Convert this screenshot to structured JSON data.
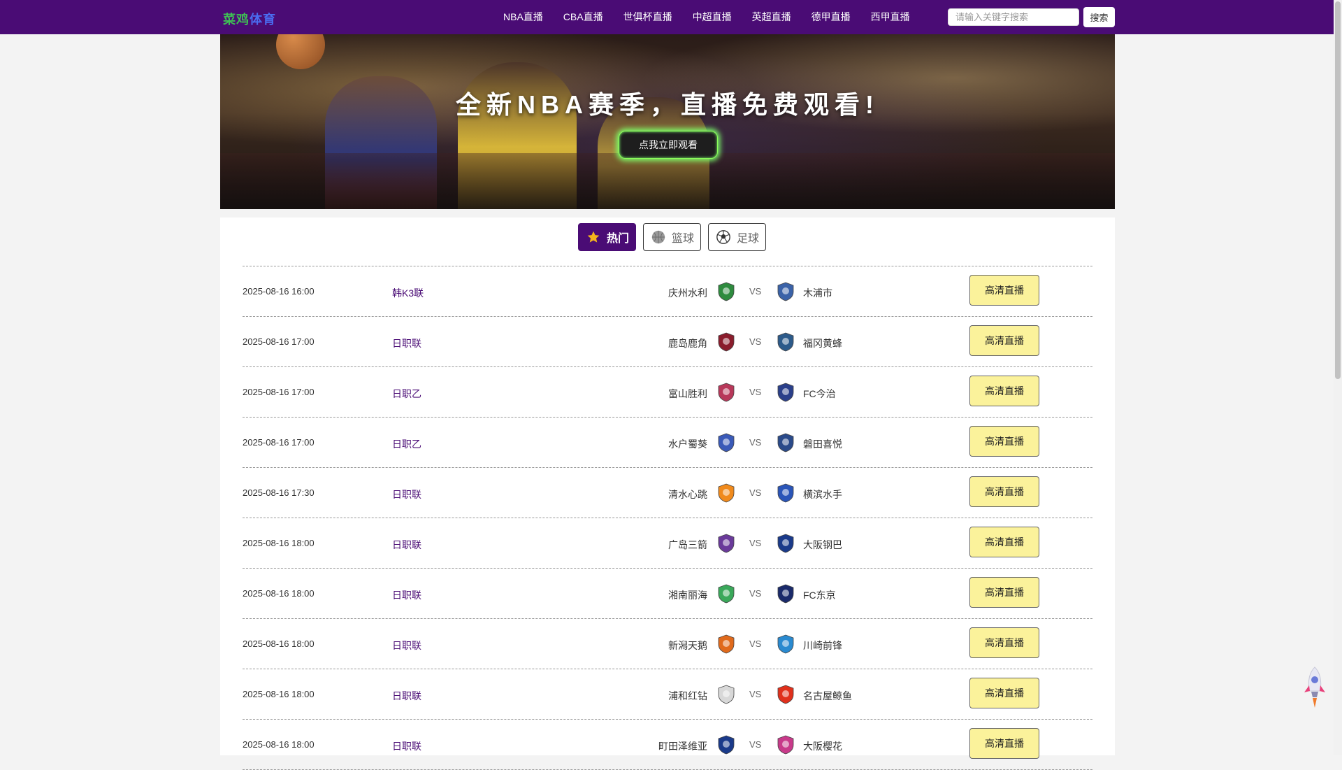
{
  "header": {
    "logo": {
      "part1": "菜鸡",
      "part2": "体育"
    },
    "nav": [
      "NBA直播",
      "CBA直播",
      "世俱杯直播",
      "中超直播",
      "英超直播",
      "德甲直播",
      "西甲直播"
    ],
    "search_placeholder": "请输入关键字搜索",
    "search_button": "搜索"
  },
  "banner": {
    "title": "全新NBA赛季，直播免费观看!",
    "button": "点我立即观看"
  },
  "tabs": [
    {
      "label": "热门",
      "icon": "star-icon",
      "active": true
    },
    {
      "label": "篮球",
      "icon": "basketball-icon",
      "active": false
    },
    {
      "label": "足球",
      "icon": "soccer-ball-icon",
      "active": false
    }
  ],
  "colors": {
    "brand": "#4a0c75",
    "live_button": "#fbf29b"
  },
  "vs_label": "VS",
  "matches": [
    {
      "time": "2025-08-16 16:00",
      "league": "韩K3联",
      "home": "庆州水利",
      "away": "木浦市",
      "button": "高清直播",
      "home_badge": "#2e8b3e",
      "away_badge": "#3a62a8"
    },
    {
      "time": "2025-08-16 17:00",
      "league": "日职联",
      "home": "鹿岛鹿角",
      "away": "福冈黄蜂",
      "button": "高清直播",
      "home_badge": "#8a1c2c",
      "away_badge": "#2c5a8a"
    },
    {
      "time": "2025-08-16 17:00",
      "league": "日职乙",
      "home": "富山胜利",
      "away": "FC今治",
      "button": "高清直播",
      "home_badge": "#b8385a",
      "away_badge": "#2a3f8a"
    },
    {
      "time": "2025-08-16 17:00",
      "league": "日职乙",
      "home": "水户蜀葵",
      "away": "磐田喜悦",
      "button": "高清直播",
      "home_badge": "#3a5ab8",
      "away_badge": "#2a4a8a"
    },
    {
      "time": "2025-08-16 17:30",
      "league": "日职联",
      "home": "清水心跳",
      "away": "横滨水手",
      "button": "高清直播",
      "home_badge": "#f08a1c",
      "away_badge": "#2a55b8"
    },
    {
      "time": "2025-08-16 18:00",
      "league": "日职联",
      "home": "广岛三箭",
      "away": "大阪钢巴",
      "button": "高清直播",
      "home_badge": "#6a3a9a",
      "away_badge": "#1a3a8a"
    },
    {
      "time": "2025-08-16 18:00",
      "league": "日职联",
      "home": "湘南丽海",
      "away": "FC东京",
      "button": "高清直播",
      "home_badge": "#3aa85a",
      "away_badge": "#1a2a6a"
    },
    {
      "time": "2025-08-16 18:00",
      "league": "日职联",
      "home": "新潟天鹅",
      "away": "川崎前锋",
      "button": "高清直播",
      "home_badge": "#e06a1c",
      "away_badge": "#2a8ad0"
    },
    {
      "time": "2025-08-16 18:00",
      "league": "日职联",
      "home": "浦和红钻",
      "away": "名古屋鲸鱼",
      "button": "高清直播",
      "home_badge": "#d8d8d8",
      "away_badge": "#e0301c"
    },
    {
      "time": "2025-08-16 18:00",
      "league": "日职联",
      "home": "町田泽维亚",
      "away": "大阪樱花",
      "button": "高清直播",
      "home_badge": "#1a3a8a",
      "away_badge": "#c83a8a"
    }
  ]
}
